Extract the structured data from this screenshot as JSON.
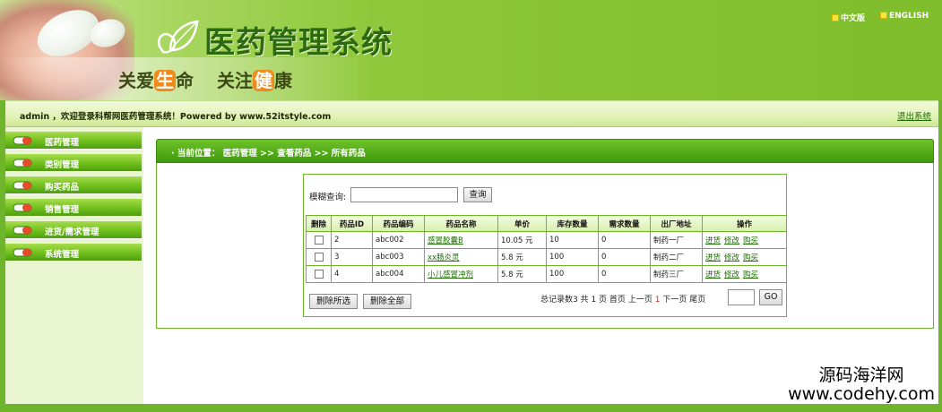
{
  "header": {
    "title": "医药管理系统",
    "slogan_part1": "关爱",
    "slogan_hl1": "生",
    "slogan_part2": "命",
    "slogan_part3": "关注",
    "slogan_hl2": "健",
    "slogan_part4": "康",
    "lang_cn": "中文版",
    "lang_en": "ENGLISH"
  },
  "welcome": {
    "message": "admin ，欢迎登录科帮网医药管理系统！Powered by www.52itstyle.com",
    "logout": "退出系统"
  },
  "sidebar": {
    "items": [
      {
        "label": "医药管理"
      },
      {
        "label": "类别管理"
      },
      {
        "label": "购买药品"
      },
      {
        "label": "销售管理"
      },
      {
        "label": "进货/需求管理"
      },
      {
        "label": "系统管理"
      }
    ]
  },
  "breadcrumb": "· 当前位置： 医药管理 >> 查看药品 >> 所有药品",
  "search": {
    "label": "模糊查询:",
    "value": "",
    "button": "查询"
  },
  "table": {
    "columns": [
      "删除",
      "药品ID",
      "药品编码",
      "药品名称",
      "单价",
      "库存数量",
      "需求数量",
      "出厂地址",
      "操作"
    ],
    "rows": [
      {
        "id": "2",
        "code": "abc002",
        "name": "感冒胶囊B",
        "price": "10.05 元",
        "stock": "10",
        "demand": "0",
        "factory": "制药一厂"
      },
      {
        "id": "3",
        "code": "abc003",
        "name": "xx肠炎灵",
        "price": "5.8 元",
        "stock": "100",
        "demand": "0",
        "factory": "制药二厂"
      },
      {
        "id": "4",
        "code": "abc004",
        "name": "小儿感冒冲剂",
        "price": "5.8 元",
        "stock": "100",
        "demand": "0",
        "factory": "制药三厂"
      }
    ],
    "actions": [
      "进货",
      "修改",
      "购买"
    ]
  },
  "buttons": {
    "delete_selected": "删除所选",
    "delete_all": "删除全部",
    "go": "GO"
  },
  "pager": {
    "summary": "总记录数3 共 1 页",
    "first": "首页",
    "prev": "上一页",
    "next": "下一页",
    "last": "尾页",
    "separator": "1",
    "page_value": ""
  },
  "watermark": {
    "line1": "源码海洋网",
    "line2": "www.codehy.com"
  }
}
